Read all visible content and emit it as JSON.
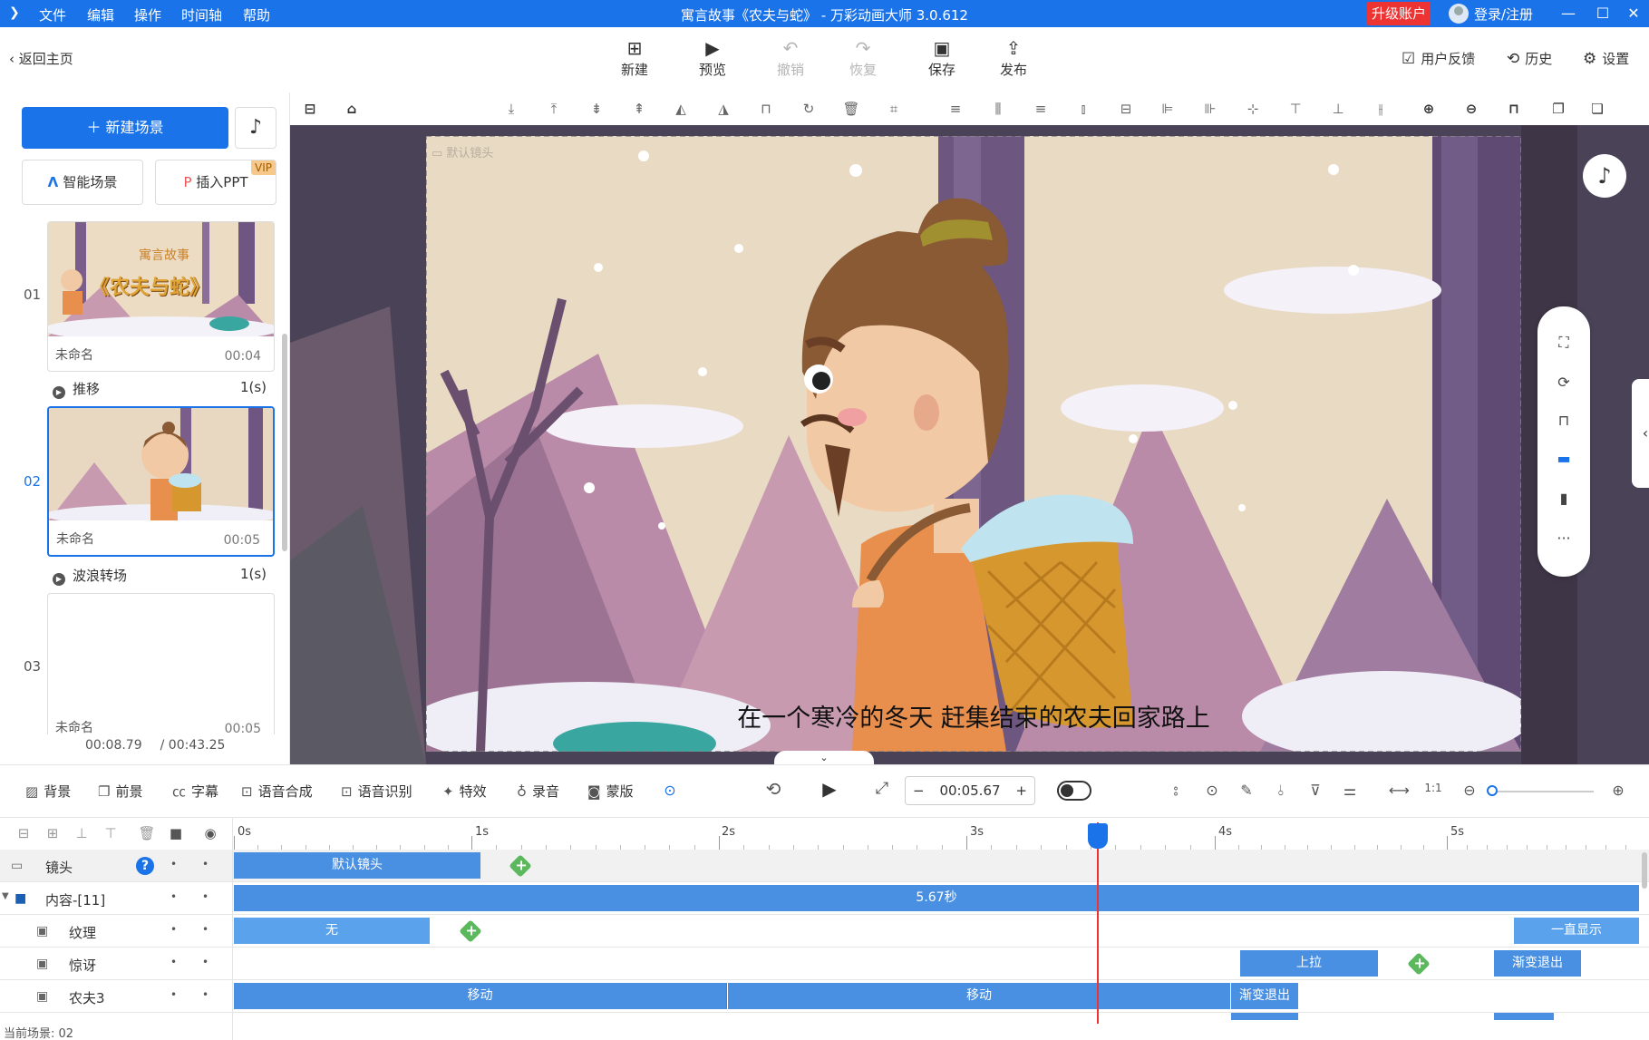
{
  "titlebar": {
    "menu": [
      "文件",
      "编辑",
      "操作",
      "时间轴",
      "帮助"
    ],
    "title": "寓言故事《农夫与蛇》 - 万彩动画大师 3.0.612",
    "upgrade": "升级账户",
    "login": "登录/注册"
  },
  "topbar": {
    "back": "返回主页",
    "tools": [
      {
        "label": "新建",
        "icon": "new-icon",
        "glyph": "⊞"
      },
      {
        "label": "预览",
        "icon": "play-icon",
        "glyph": "▶"
      },
      {
        "label": "撤销",
        "icon": "undo-icon",
        "glyph": "↶"
      },
      {
        "label": "恢复",
        "icon": "redo-icon",
        "glyph": "↷"
      },
      {
        "label": "保存",
        "icon": "save-icon",
        "glyph": "▣"
      },
      {
        "label": "发布",
        "icon": "publish-icon",
        "glyph": "⇪"
      }
    ],
    "right": [
      {
        "label": "用户反馈",
        "glyph": "☑"
      },
      {
        "label": "历史",
        "glyph": "⟲"
      },
      {
        "label": "设置",
        "glyph": "⚙"
      }
    ]
  },
  "left": {
    "new_scene": "＋ 新建场景",
    "smart_scene": "智能场景",
    "insert_ppt": "插入PPT",
    "vip": "VIP",
    "scenes": [
      {
        "num": "01",
        "name": "未命名",
        "dur": "00:04",
        "thumb_title": "寓言故事",
        "thumb_sub": "《农夫与蛇》"
      },
      {
        "num": "02",
        "name": "未命名",
        "dur": "00:05"
      },
      {
        "num": "03",
        "name": "未命名",
        "dur": "00:05"
      }
    ],
    "transitions": [
      {
        "name": "推移",
        "time": "1(s)"
      },
      {
        "name": "波浪转场",
        "time": "1(s)"
      }
    ],
    "time_current": "00:08.79",
    "time_total": "/ 00:43.25"
  },
  "canvas": {
    "camera_label": "默认镜头",
    "subtitle": "在一个寒冷的冬天 赶集结束的农夫回家路上"
  },
  "bottom_tools": [
    {
      "label": "背景",
      "glyph": "▨"
    },
    {
      "label": "前景",
      "glyph": "❐"
    },
    {
      "label": "字幕",
      "glyph": "㏄"
    },
    {
      "label": "语音合成",
      "glyph": "⊡"
    },
    {
      "label": "语音识别",
      "glyph": "⊡"
    },
    {
      "label": "特效",
      "glyph": "✦"
    },
    {
      "label": "录音",
      "glyph": "♁"
    },
    {
      "label": "蒙版",
      "glyph": "◙"
    }
  ],
  "playback": {
    "time": "00:05.67",
    "minus": "−",
    "plus": "+"
  },
  "timeline": {
    "ticks": [
      "0s",
      "1s",
      "2s",
      "3s",
      "4s",
      "5s"
    ],
    "rows": {
      "camera": {
        "label": "镜头",
        "clip": "默认镜头"
      },
      "content": {
        "label": "内容-[11]",
        "clip": "5.67秒"
      },
      "texture": {
        "label": "纹理",
        "clip1": "无",
        "clip2": "一直显示"
      },
      "surprise": {
        "label": "惊讶",
        "clip1": "上拉",
        "clip2": "渐变退出"
      },
      "farmer": {
        "label": "农夫3",
        "clip1": "移动",
        "clip2": "移动",
        "clip3": "渐变退出"
      }
    },
    "current_scene": "当前场景: 02"
  },
  "colors": {
    "accent": "#1a73e8",
    "clip": "#4a90e2",
    "keyframe": "#5cb85c",
    "playhead": "#e33333",
    "upgrade": "#e33333"
  }
}
